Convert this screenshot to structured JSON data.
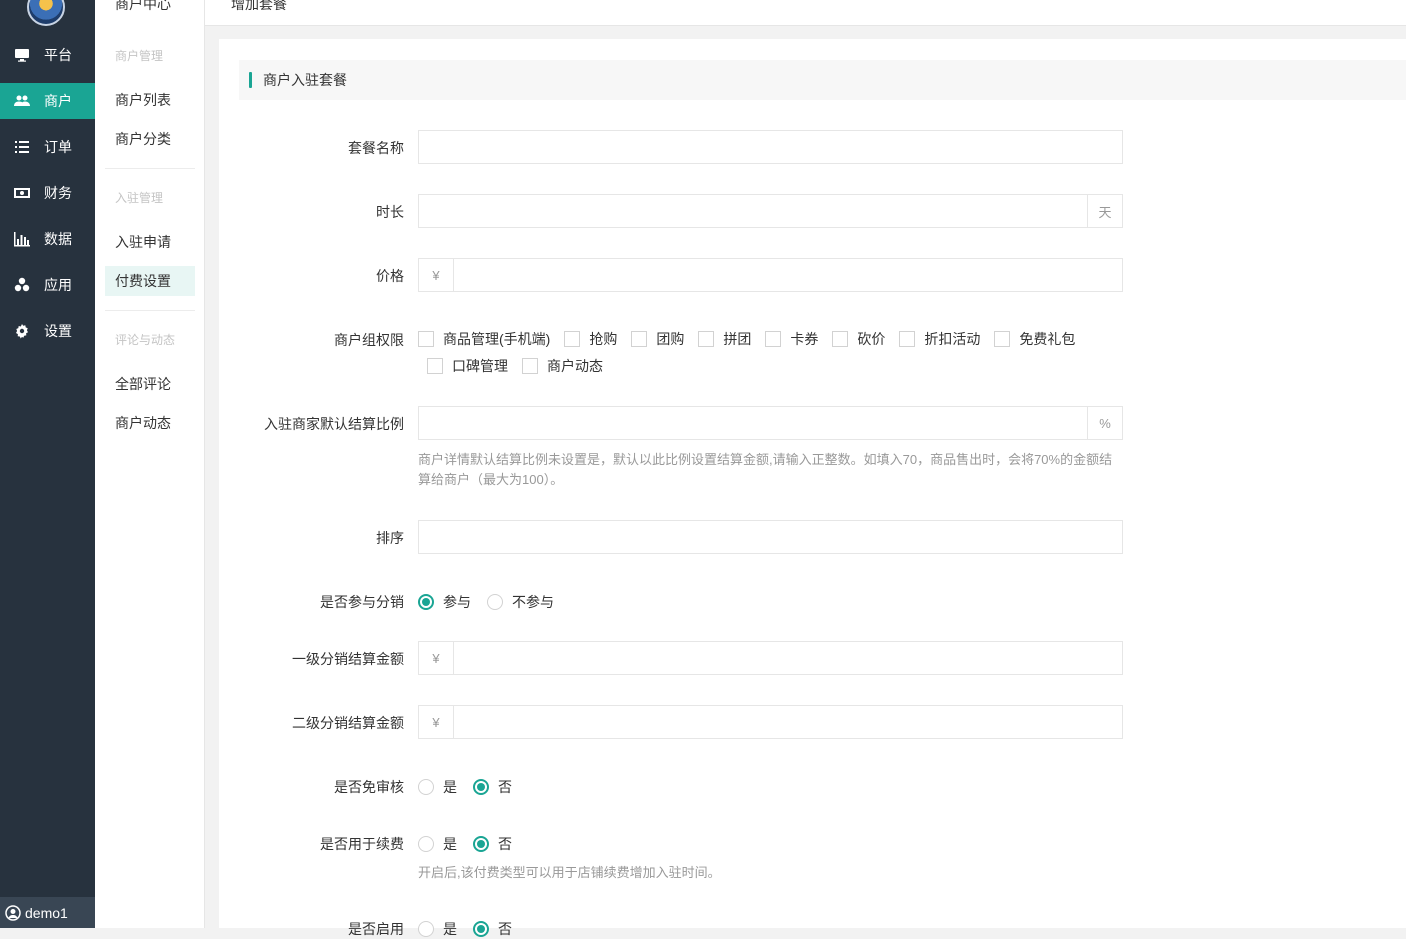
{
  "sidebar": {
    "items": [
      {
        "label": "平台",
        "icon": "monitor-icon"
      },
      {
        "label": "商户",
        "icon": "users-icon"
      },
      {
        "label": "订单",
        "icon": "list-icon"
      },
      {
        "label": "财务",
        "icon": "money-icon"
      },
      {
        "label": "数据",
        "icon": "bar-chart-icon"
      },
      {
        "label": "应用",
        "icon": "cubes-icon"
      },
      {
        "label": "设置",
        "icon": "gear-icon"
      }
    ],
    "active_index": 1,
    "user": "demo1"
  },
  "subnav": {
    "top": "商户中心",
    "groups": [
      {
        "title": "商户管理",
        "items": [
          "商户列表",
          "商户分类"
        ]
      },
      {
        "title": "入驻管理",
        "items": [
          "入驻申请",
          "付费设置"
        ]
      },
      {
        "title": "评论与动态",
        "items": [
          "全部评论",
          "商户动态"
        ]
      }
    ],
    "active_item": "付费设置"
  },
  "breadcrumb": "增加套餐",
  "section_title": "商户入驻套餐",
  "form": {
    "name_label": "套餐名称",
    "duration_label": "时长",
    "duration_unit": "天",
    "price_label": "价格",
    "currency": "¥",
    "perm_label": "商户组权限",
    "permissions": [
      "商品管理(手机端)",
      "抢购",
      "团购",
      "拼团",
      "卡券",
      "砍价",
      "折扣活动",
      "免费礼包",
      "口碑管理",
      "商户动态"
    ],
    "ratio_label": "入驻商家默认结算比例",
    "ratio_unit": "%",
    "ratio_hint": "商户详情默认结算比例未设置是，默认以此比例设置结算金额,请输入正整数。如填入70，商品售出时，会将70%的金额结算给商户（最大为100）。",
    "sort_label": "排序",
    "dist_label": "是否参与分销",
    "dist_options": [
      "参与",
      "不参与"
    ],
    "dist_selected": "参与",
    "level1_label": "一级分销结算金额",
    "level2_label": "二级分销结算金额",
    "audit_label": "是否免审核",
    "yes": "是",
    "no": "否",
    "audit_selected": "否",
    "renew_label": "是否用于续费",
    "renew_selected": "否",
    "renew_hint": "开启后,该付费类型可以用于店铺续费增加入驻时间。",
    "enable_label": "是否启用",
    "enable_selected": "否"
  },
  "colors": {
    "accent": "#1aa594",
    "sidebar": "#27323e"
  }
}
